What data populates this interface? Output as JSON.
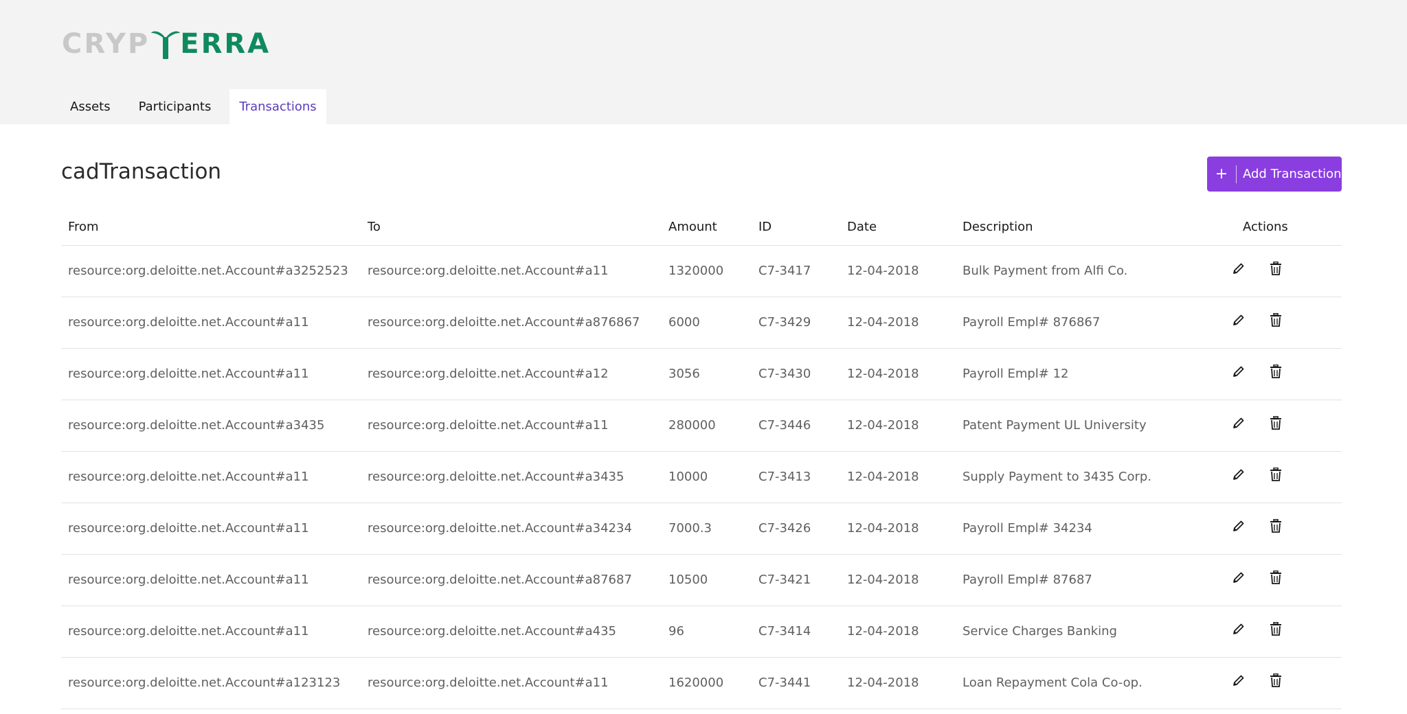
{
  "brand": {
    "logo_part1": "CRYP",
    "logo_part2": "ERRA",
    "logo_gray": "#c8c8c8",
    "logo_green": "#0f8a5f"
  },
  "nav": {
    "tabs": [
      {
        "label": "Assets",
        "active": false
      },
      {
        "label": "Participants",
        "active": false
      },
      {
        "label": "Transactions",
        "active": true
      }
    ]
  },
  "page": {
    "title": "cadTransaction",
    "add_button_label": "Add Transaction",
    "add_button_icon": "plus-icon",
    "accent_color": "#8a3ee0"
  },
  "table": {
    "headers": {
      "from": "From",
      "to": "To",
      "amount": "Amount",
      "id": "ID",
      "date": "Date",
      "description": "Description",
      "actions": "Actions"
    },
    "action_icons": [
      "pencil-icon",
      "trash-icon"
    ],
    "rows": [
      {
        "from": "resource:org.deloitte.net.Account#a3252523",
        "to": "resource:org.deloitte.net.Account#a11",
        "amount": "1320000",
        "id": "C7-3417",
        "date": "12-04-2018",
        "description": "Bulk Payment from Alfi Co."
      },
      {
        "from": "resource:org.deloitte.net.Account#a11",
        "to": "resource:org.deloitte.net.Account#a876867",
        "amount": "6000",
        "id": "C7-3429",
        "date": "12-04-2018",
        "description": "Payroll Empl# 876867"
      },
      {
        "from": "resource:org.deloitte.net.Account#a11",
        "to": "resource:org.deloitte.net.Account#a12",
        "amount": "3056",
        "id": "C7-3430",
        "date": "12-04-2018",
        "description": "Payroll Empl# 12"
      },
      {
        "from": "resource:org.deloitte.net.Account#a3435",
        "to": "resource:org.deloitte.net.Account#a11",
        "amount": "280000",
        "id": "C7-3446",
        "date": "12-04-2018",
        "description": "Patent Payment UL University"
      },
      {
        "from": "resource:org.deloitte.net.Account#a11",
        "to": "resource:org.deloitte.net.Account#a3435",
        "amount": "10000",
        "id": "C7-3413",
        "date": "12-04-2018",
        "description": "Supply Payment to 3435 Corp."
      },
      {
        "from": "resource:org.deloitte.net.Account#a11",
        "to": "resource:org.deloitte.net.Account#a34234",
        "amount": "7000.3",
        "id": "C7-3426",
        "date": "12-04-2018",
        "description": "Payroll Empl# 34234"
      },
      {
        "from": "resource:org.deloitte.net.Account#a11",
        "to": "resource:org.deloitte.net.Account#a87687",
        "amount": "10500",
        "id": "C7-3421",
        "date": "12-04-2018",
        "description": "Payroll Empl# 87687"
      },
      {
        "from": "resource:org.deloitte.net.Account#a11",
        "to": "resource:org.deloitte.net.Account#a435",
        "amount": "96",
        "id": "C7-3414",
        "date": "12-04-2018",
        "description": "Service Charges Banking"
      },
      {
        "from": "resource:org.deloitte.net.Account#a123123",
        "to": "resource:org.deloitte.net.Account#a11",
        "amount": "1620000",
        "id": "C7-3441",
        "date": "12-04-2018",
        "description": "Loan Repayment Cola Co-op."
      }
    ]
  }
}
